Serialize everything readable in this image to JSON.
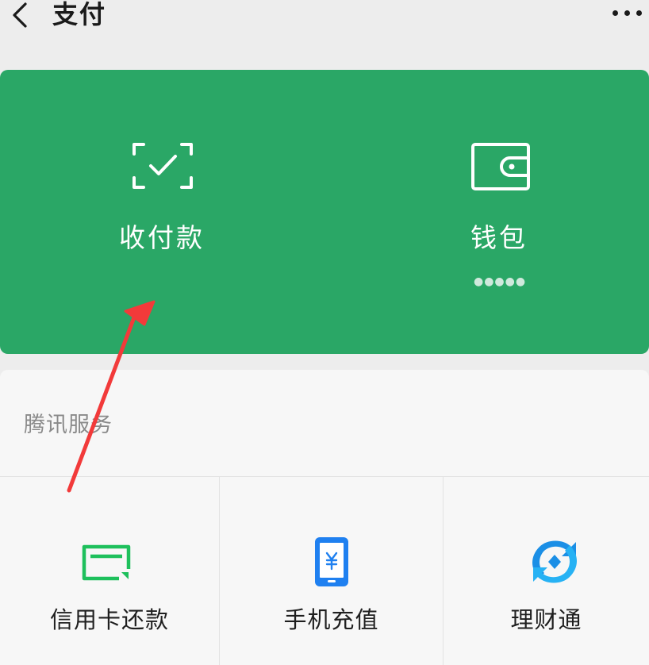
{
  "header": {
    "title": "支付",
    "back_icon": "chevron-left-icon",
    "more_icon": "more-dots-icon"
  },
  "card": {
    "background": "#2aa766",
    "items": [
      {
        "label": "收付款",
        "icon": "scan-check-icon"
      },
      {
        "label": "钱包",
        "icon": "wallet-icon",
        "sub": "●●●●●"
      }
    ]
  },
  "services": {
    "title": "腾讯服务",
    "items": [
      {
        "label": "信用卡还款",
        "icon": "credit-card-icon",
        "color": "#1ec05c"
      },
      {
        "label": "手机充值",
        "icon": "phone-yuan-icon",
        "color": "#1f80f0"
      },
      {
        "label": "理财通",
        "icon": "licaitong-icon",
        "color": "#1b8fe6"
      }
    ]
  },
  "annotation": {
    "arrow_color": "#f23a3a"
  }
}
